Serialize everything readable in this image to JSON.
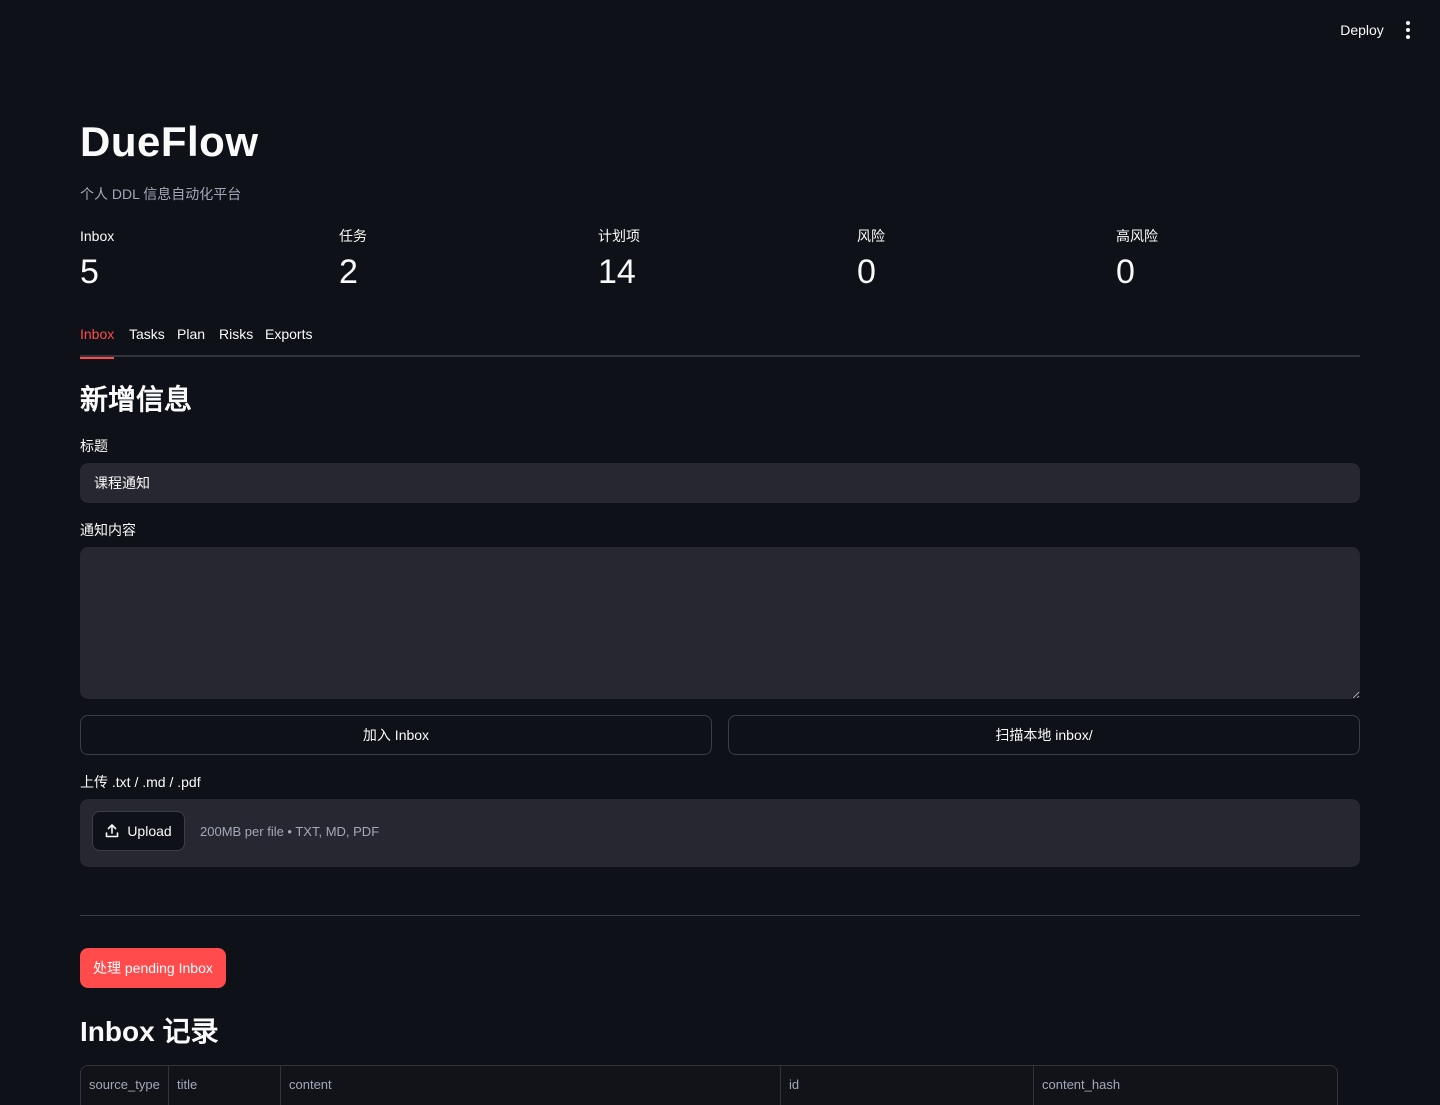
{
  "header": {
    "deploy_label": "Deploy",
    "menu_icon": "kebab-menu-icon"
  },
  "app": {
    "title": "DueFlow",
    "subtitle": "个人 DDL 信息自动化平台"
  },
  "metrics": [
    {
      "label": "Inbox",
      "value": "5"
    },
    {
      "label": "任务",
      "value": "2"
    },
    {
      "label": "计划项",
      "value": "14"
    },
    {
      "label": "风险",
      "value": "0"
    },
    {
      "label": "高风险",
      "value": "0"
    }
  ],
  "tabs": [
    {
      "label": "Inbox",
      "active": true
    },
    {
      "label": "Tasks",
      "active": false
    },
    {
      "label": "Plan",
      "active": false
    },
    {
      "label": "Risks",
      "active": false
    },
    {
      "label": "Exports",
      "active": false
    }
  ],
  "form": {
    "section_title": "新增信息",
    "title_label": "标题",
    "title_value": "课程通知",
    "content_label": "通知内容",
    "content_value": "",
    "add_button": "加入 Inbox",
    "scan_button": "扫描本地 inbox/",
    "upload_label": "上传 .txt / .md / .pdf",
    "upload_button": "Upload",
    "upload_hint": "200MB per file • TXT, MD, PDF"
  },
  "actions": {
    "process_button": "处理 pending Inbox"
  },
  "records": {
    "title": "Inbox 记录",
    "columns": [
      "source_type",
      "title",
      "content",
      "id",
      "content_hash"
    ]
  },
  "colors": {
    "background": "#0e1117",
    "input_bg": "#262730",
    "accent": "#ff4b4b",
    "muted_text": "#a3a8b8"
  }
}
